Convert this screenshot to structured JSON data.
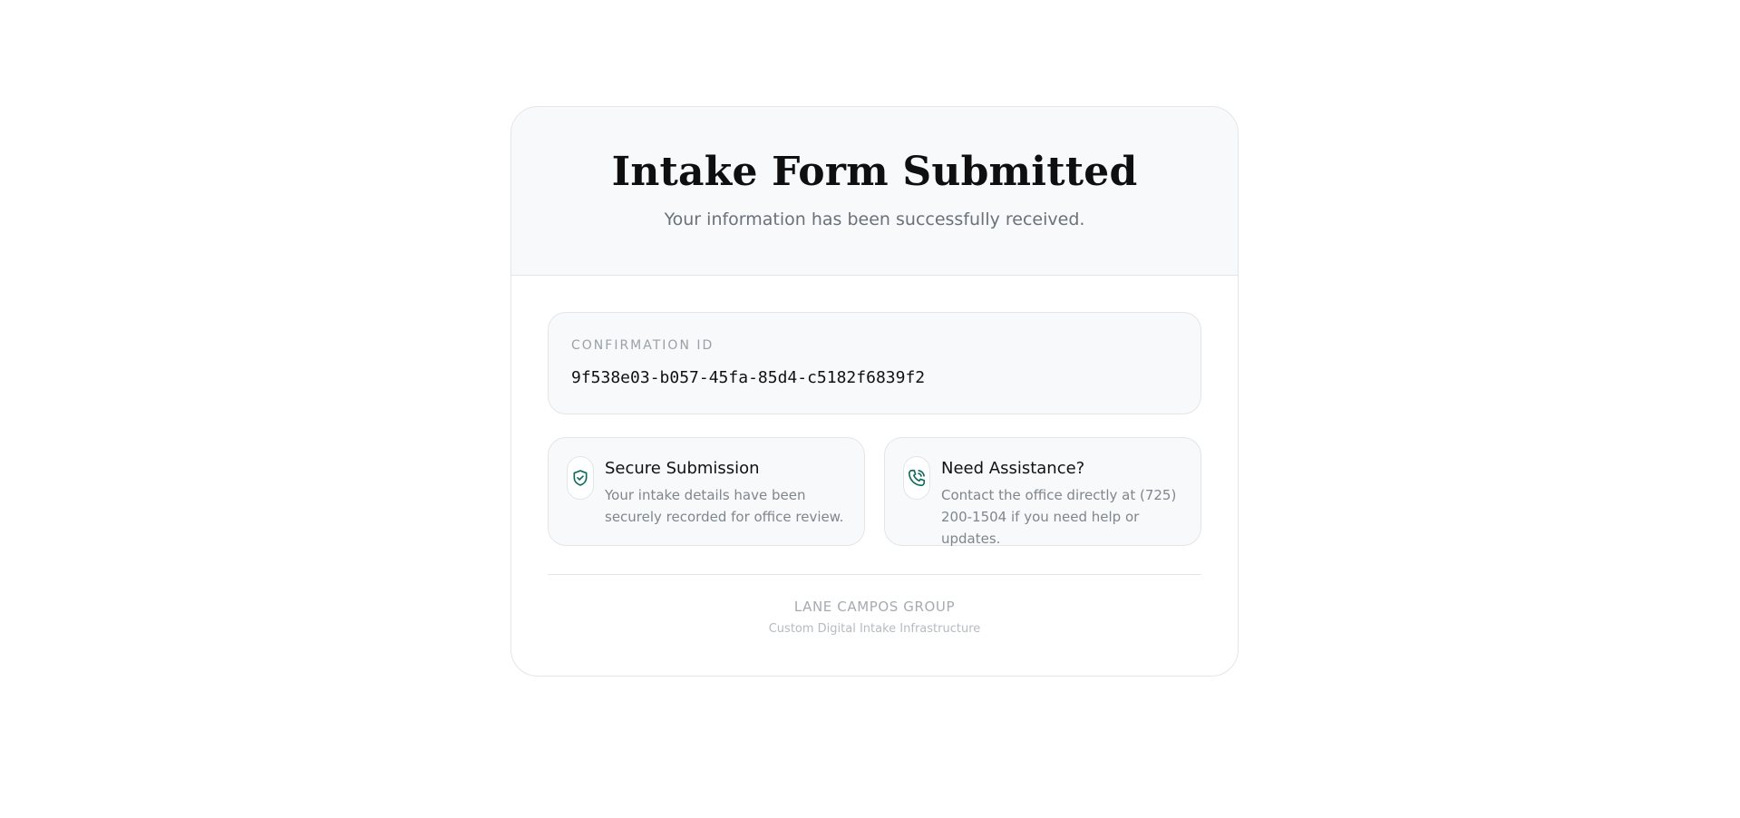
{
  "header": {
    "title": "Intake Form Submitted",
    "subtitle": "Your information has been successfully received."
  },
  "confirmation": {
    "label": "CONFIRMATION ID",
    "value": "9f538e03-b057-45fa-85d4-c5182f6839f2"
  },
  "info_cards": [
    {
      "icon": "shield-check-icon",
      "title": "Secure Submission",
      "description": "Your intake details have been securely recorded for office review."
    },
    {
      "icon": "phone-icon",
      "title": "Need Assistance?",
      "description": "Contact the office directly at (725) 200-1504 if you need help or updates."
    }
  ],
  "footer": {
    "organization": "LANE CAMPOS GROUP",
    "tagline": "Custom Digital Intake Infrastructure"
  },
  "colors": {
    "accent": "#0f6b5a",
    "panel_background": "#f8f9fa",
    "border": "#e3e5e8"
  }
}
